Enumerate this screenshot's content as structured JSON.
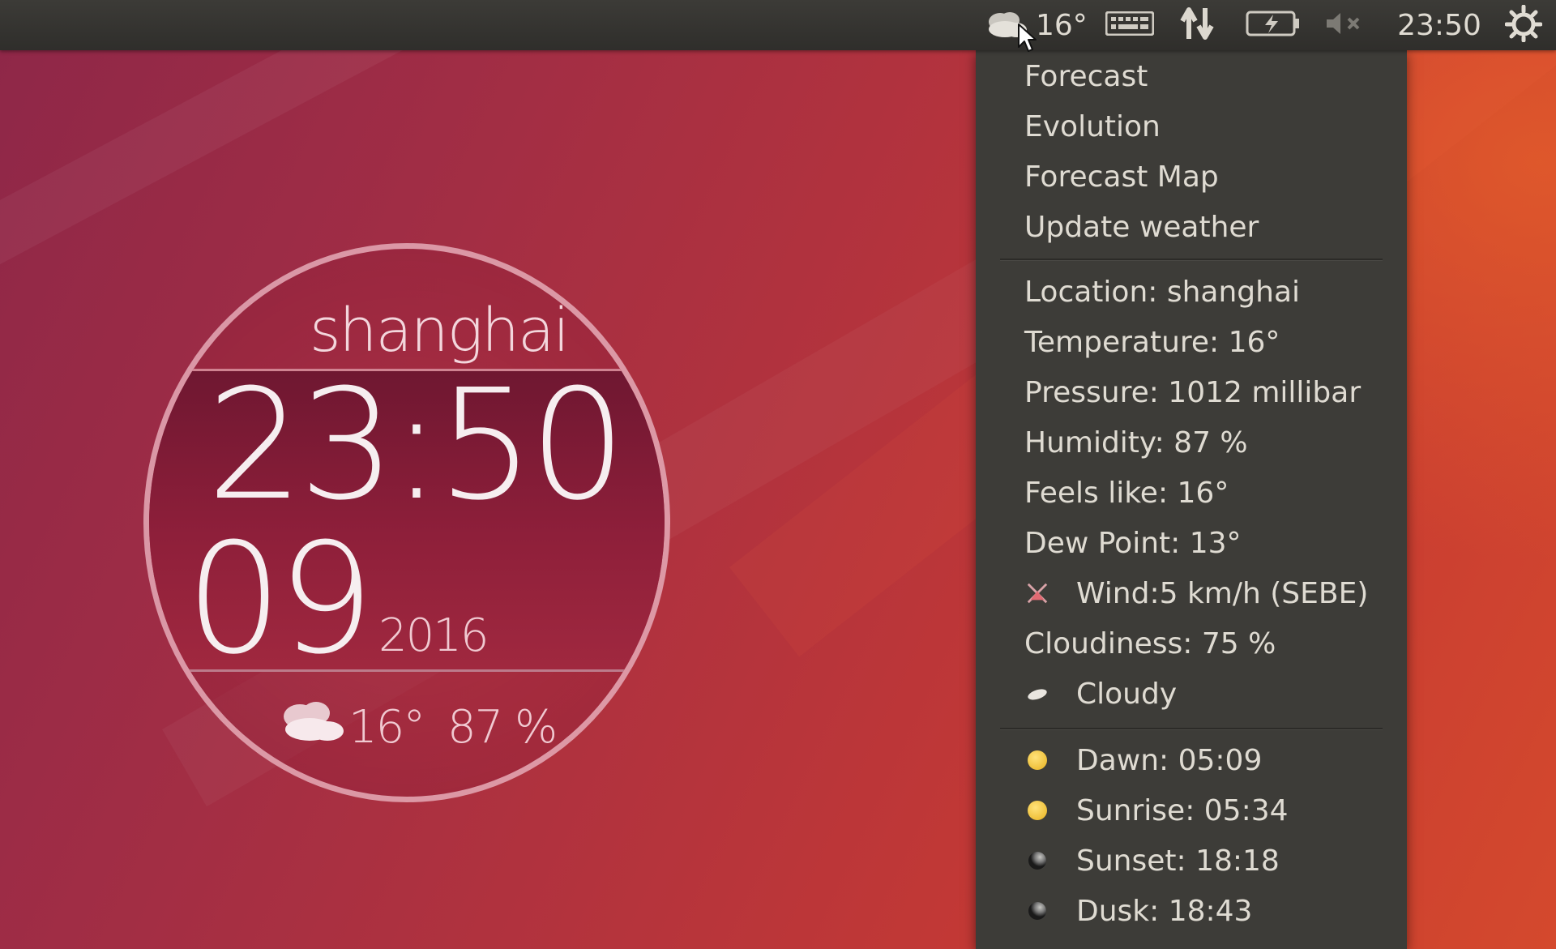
{
  "top_panel": {
    "weather_temp": "16°",
    "clock": "23:50",
    "icons": [
      "cloudy-weather-icon",
      "keyboard-icon",
      "network-icon",
      "battery-icon",
      "volume-muted-icon",
      "power-icon"
    ]
  },
  "clock_widget": {
    "city": "shanghai",
    "time": "23:50",
    "day": "09",
    "year": "2016",
    "temperature": "16°",
    "humidity": "87 %"
  },
  "weather_menu": {
    "actions": [
      {
        "label": "Forecast"
      },
      {
        "label": "Evolution"
      },
      {
        "label": "Forecast Map"
      },
      {
        "label": "Update weather"
      }
    ],
    "details": [
      {
        "label": "Location: shanghai"
      },
      {
        "label": "Temperature: 16°"
      },
      {
        "label": "Pressure: 1012 millibar"
      },
      {
        "label": "Humidity: 87 %"
      },
      {
        "label": "Feels like: 16°"
      },
      {
        "label": "Dew Point: 13°"
      }
    ],
    "wind": {
      "label": "Wind:5 km/h (SEBE)",
      "icon": "wind-direction-icon"
    },
    "cloudiness": {
      "label": "Cloudiness: 75 %"
    },
    "condition": {
      "label": "Cloudy",
      "icon": "cloud-icon"
    },
    "sun_times": [
      {
        "label": "Dawn: 05:09",
        "icon": "sun-icon"
      },
      {
        "label": "Sunrise: 05:34",
        "icon": "sun-icon"
      },
      {
        "label": "Sunset: 18:18",
        "icon": "moon-icon"
      },
      {
        "label": "Dusk: 18:43",
        "icon": "moon-icon"
      }
    ]
  },
  "colors": {
    "panel": "#3c3b37",
    "menu": "#3d3c38",
    "menu_text": "#dfdbd2",
    "sun": "#e8b21f"
  }
}
